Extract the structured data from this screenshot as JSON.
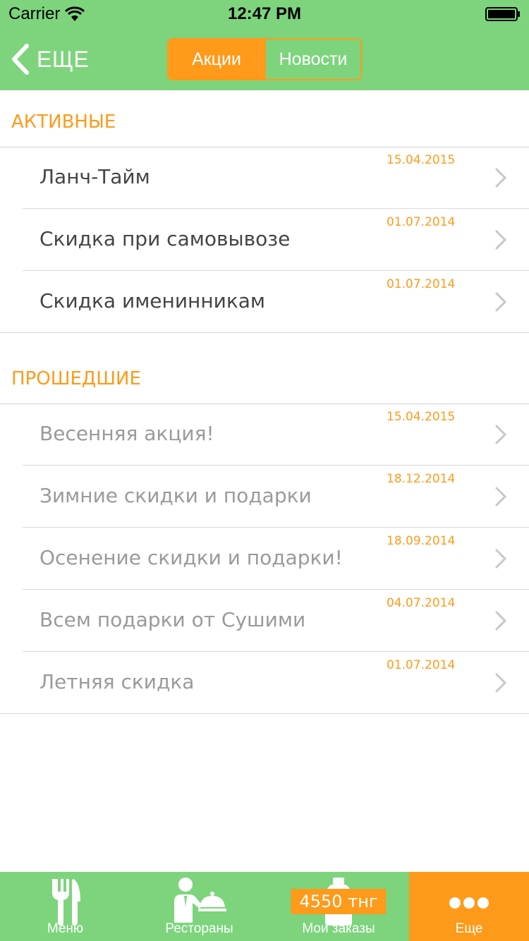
{
  "status_bar": {
    "carrier": "Carrier",
    "time": "12:47 PM"
  },
  "nav": {
    "back_label": "ЕЩЕ",
    "segments": [
      {
        "label": "Акции",
        "selected": true
      },
      {
        "label": "Новости",
        "selected": false
      }
    ]
  },
  "sections": {
    "active": {
      "title": "АКТИВНЫЕ",
      "items": [
        {
          "title": "Ланч-Тайм",
          "date": "15.04.2015"
        },
        {
          "title": "Скидка при самовывозе",
          "date": "01.07.2014"
        },
        {
          "title": "Скидка именинникам",
          "date": "01.07.2014"
        }
      ]
    },
    "past": {
      "title": "ПРОШЕДШИЕ",
      "items": [
        {
          "title": "Весенняя акция!",
          "date": "15.04.2015"
        },
        {
          "title": "Зимние скидки и подарки",
          "date": "18.12.2014"
        },
        {
          "title": "Осенение скидки и подарки!",
          "date": "18.09.2014"
        },
        {
          "title": "Всем подарки от Сушими",
          "date": "04.07.2014"
        },
        {
          "title": "Летняя скидка",
          "date": "01.07.2014"
        }
      ]
    }
  },
  "tabbar": {
    "tabs": [
      {
        "label": "Меню",
        "icon": "fork-knife-icon"
      },
      {
        "label": "Рестораны",
        "icon": "waiter-icon"
      },
      {
        "label": "Мои заказы",
        "icon": "bottle-icon",
        "badge": "4550 тнг"
      },
      {
        "label": "Еще",
        "icon": "more-dots-icon",
        "selected": true
      }
    ]
  },
  "colors": {
    "header_green": "#7dd47d",
    "accent_orange": "#ff9a1a",
    "active_text": "#444444",
    "past_text": "#9a9a9a"
  }
}
